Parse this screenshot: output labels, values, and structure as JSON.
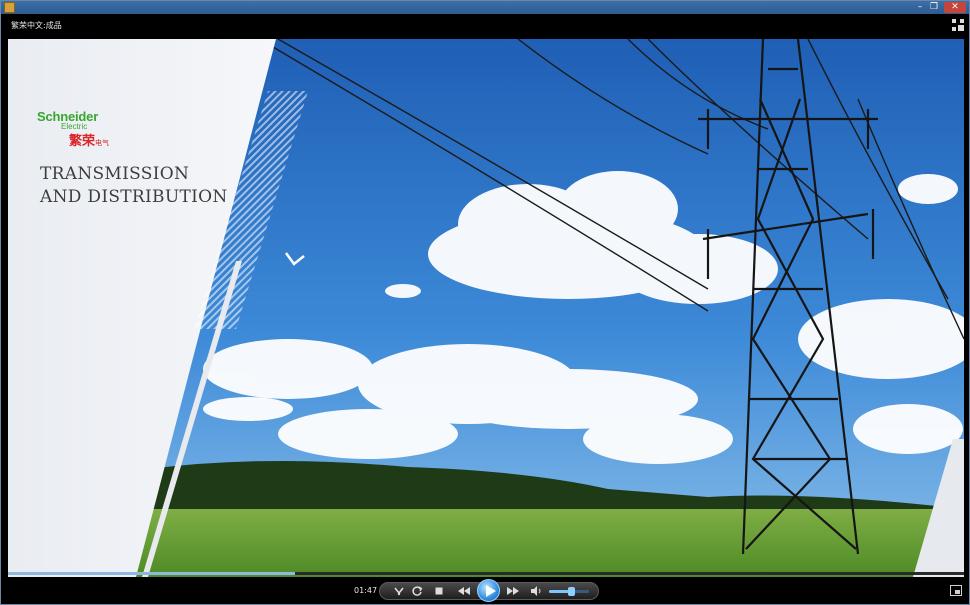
{
  "window": {
    "title": "繁荣中文:成品",
    "min_glyph": "–",
    "max_glyph": "❐",
    "close_glyph": "✕"
  },
  "video": {
    "brand_top": "Schneider",
    "brand_bottom": "Electric",
    "brand_cn": "繁荣",
    "brand_cn_small": "电气",
    "headline_line1": "TRANSMISSION",
    "headline_line2": "AND DISTRIBUTION"
  },
  "player": {
    "time": "01:47",
    "progress_fraction": 0.3,
    "volume_fraction": 0.55,
    "icons": {
      "repeat": "repeat-icon",
      "refresh": "refresh-icon",
      "stop": "stop-icon",
      "rewind": "rewind-icon",
      "play": "play-icon",
      "forward": "fast-forward-icon",
      "volume": "volume-icon",
      "fullscreen": "fullscreen-icon",
      "mini_mode": "mini-mode-icon"
    }
  }
}
